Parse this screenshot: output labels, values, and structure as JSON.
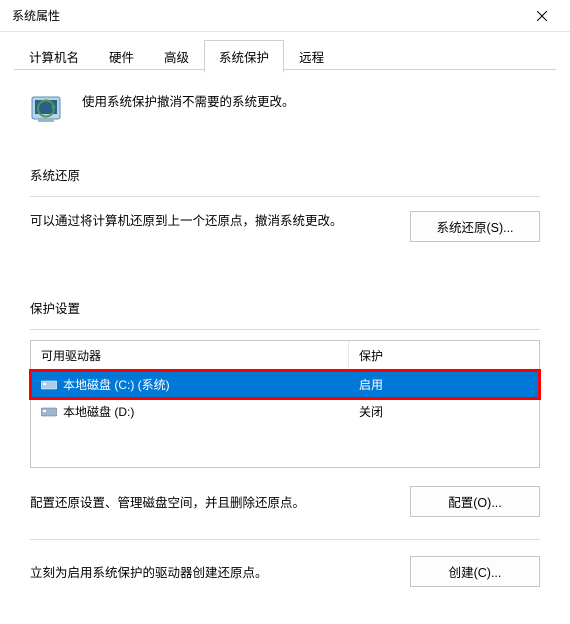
{
  "window": {
    "title": "系统属性"
  },
  "tabs": {
    "computer_name": "计算机名",
    "hardware": "硬件",
    "advanced": "高级",
    "system_protection": "系统保护",
    "remote": "远程"
  },
  "intro": "使用系统保护撤消不需要的系统更改。",
  "restore": {
    "title": "系统还原",
    "desc": "可以通过将计算机还原到上一个还原点，撤消系统更改。",
    "button": "系统还原(S)..."
  },
  "protection": {
    "title": "保护设置",
    "headers": {
      "drive": "可用驱动器",
      "protection": "保护"
    },
    "drives": [
      {
        "name": "本地磁盘 (C:) (系统)",
        "status": "启用",
        "selected": true,
        "highlight": true
      },
      {
        "name": "本地磁盘 (D:)",
        "status": "关闭",
        "selected": false,
        "highlight": false
      }
    ],
    "configure_desc": "配置还原设置、管理磁盘空间，并且删除还原点。",
    "configure_btn": "配置(O)...",
    "create_desc": "立刻为启用系统保护的驱动器创建还原点。",
    "create_btn": "创建(C)..."
  }
}
